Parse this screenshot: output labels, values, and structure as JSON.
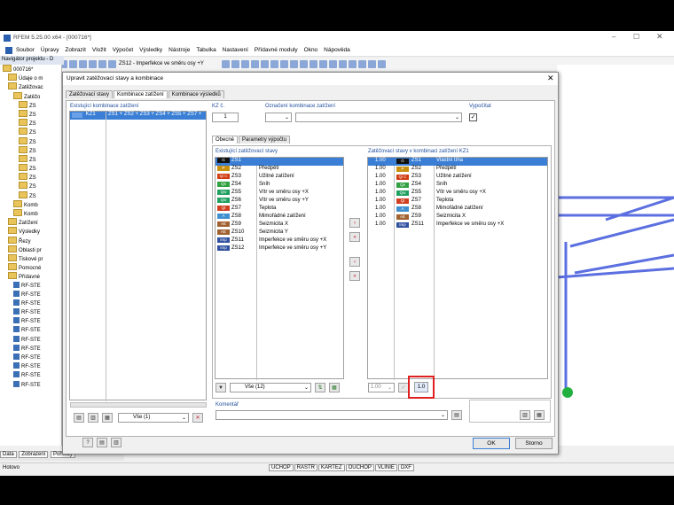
{
  "app": {
    "title": "RFEM 5.25.00 x64 - [000716*]",
    "menu": [
      "Soubor",
      "Úpravy",
      "Zobrazit",
      "Vložit",
      "Výpočet",
      "Výsledky",
      "Nástroje",
      "Tabulka",
      "Nastavení",
      "Přídavné moduly",
      "Okno",
      "Nápověda"
    ],
    "toolbar_case_label": "ZS12 - Imperfekce ve směru osy +Y",
    "status_left": "Hotovo",
    "status_buttons": [
      "UCHOP",
      "RASTR",
      "KARTEZ",
      "OUCHOP",
      "VLINIE",
      "DXF"
    ],
    "nav_tabs": [
      "Data",
      "Zobrazení",
      "Pohledy"
    ]
  },
  "navigator": {
    "title": "Navigátor projektu - D",
    "items": [
      "000716*",
      "Údaje o m",
      "Zatěžovac",
      "Zatěžo",
      "ZS",
      "ZS",
      "ZS",
      "ZS",
      "ZS",
      "ZS",
      "ZS",
      "ZS",
      "ZS",
      "ZS",
      "ZS",
      "Komb",
      "Komb",
      "Zatížení",
      "Výsledky",
      "Řezy",
      "Oblasti pr",
      "Tiskové pr",
      "Pomocné",
      "Přídavné",
      "RF-STE",
      "RF-STE",
      "RF-STE",
      "RF-STE",
      "RF-STE",
      "RF-STE",
      "RF-STE",
      "RF-STE",
      "RF-STE",
      "RF-STE",
      "RF-STE",
      "RF-STE"
    ]
  },
  "dialog": {
    "title": "Upravit zatěžovací stavy a kombinace",
    "tabs": [
      "Zatěžovací stavy",
      "Kombinace zatížení",
      "Kombinace výsledků"
    ],
    "existing_label": "Existující kombinace zatížení",
    "existing_row": {
      "id": "KZ1",
      "formula": "ZS1 + ZS2 + ZS3 + ZS4 + ZS5 + ZS7 +"
    },
    "kz_label": "KZ č.",
    "kz_value": "1",
    "designation_label": "Označení kombinace zatížení",
    "calculate_label": "Vypočítat",
    "inner_tabs": [
      "Obecné",
      "Parametry výpočtu"
    ],
    "existing_cases_label": "Existující zatěžovací stavy",
    "in_combo_label": "Zatěžovací stavy v kombinaci zatížení KZ1",
    "filter_value": "Vše (12)",
    "left_filter_value": "Vše (1)",
    "factor_value": "1.00",
    "factor_button": "1.0",
    "comment_label": "Komentář",
    "ok_label": "OK",
    "cancel_label": "Storno",
    "load_cases": [
      {
        "badge": "G",
        "color": "#111111",
        "id": "ZS1",
        "name": ""
      },
      {
        "badge": "P",
        "color": "#c89010",
        "id": "ZS2",
        "name": "Předpětí"
      },
      {
        "badge": "Qi C",
        "color": "#d03a10",
        "id": "ZS3",
        "name": "Užitné zatížení"
      },
      {
        "badge": "Qs",
        "color": "#30a040",
        "id": "ZS4",
        "name": "Sníh"
      },
      {
        "badge": "Qw",
        "color": "#20a060",
        "id": "ZS5",
        "name": "Vítr ve směru osy +X"
      },
      {
        "badge": "Qw",
        "color": "#20a060",
        "id": "ZS6",
        "name": "Vítr ve směru osy +Y"
      },
      {
        "badge": "Qt",
        "color": "#d04020",
        "id": "ZS7",
        "name": "Teplota"
      },
      {
        "badge": "A",
        "color": "#4090d0",
        "id": "ZS8",
        "name": "Mimořádné zatížení"
      },
      {
        "badge": "AE",
        "color": "#a06030",
        "id": "ZS9",
        "name": "Seizmicita X"
      },
      {
        "badge": "AE",
        "color": "#a06030",
        "id": "ZS10",
        "name": "Seizmicita Y"
      },
      {
        "badge": "Imp",
        "color": "#3050a0",
        "id": "ZS11",
        "name": "Imperfekce ve směru osy +X"
      },
      {
        "badge": "Imp",
        "color": "#3050a0",
        "id": "ZS12",
        "name": "Imperfekce ve směru osy +Y"
      }
    ],
    "combo_cases": [
      {
        "factor": "1.00",
        "badge": "G",
        "color": "#111111",
        "id": "ZS1",
        "name": "Vlastní tíha"
      },
      {
        "factor": "1.00",
        "badge": "P",
        "color": "#c89010",
        "id": "ZS2",
        "name": "Předpětí"
      },
      {
        "factor": "1.00",
        "badge": "Qi C",
        "color": "#d03a10",
        "id": "ZS3",
        "name": "Užitné zatížení"
      },
      {
        "factor": "1.00",
        "badge": "Qs",
        "color": "#30a040",
        "id": "ZS4",
        "name": "Sníh"
      },
      {
        "factor": "1.00",
        "badge": "Qw",
        "color": "#20a060",
        "id": "ZS5",
        "name": "Vítr ve směru osy +X"
      },
      {
        "factor": "1.00",
        "badge": "Qt",
        "color": "#d04020",
        "id": "ZS7",
        "name": "Teplota"
      },
      {
        "factor": "1.00",
        "badge": "A",
        "color": "#4090d0",
        "id": "ZS8",
        "name": "Mimořádné zatížení"
      },
      {
        "factor": "1.00",
        "badge": "AE",
        "color": "#a06030",
        "id": "ZS9",
        "name": "Seizmicita X"
      },
      {
        "factor": "1.00",
        "badge": "Imp",
        "color": "#3050a0",
        "id": "ZS11",
        "name": "Imperfekce ve směru osy +X"
      }
    ]
  }
}
